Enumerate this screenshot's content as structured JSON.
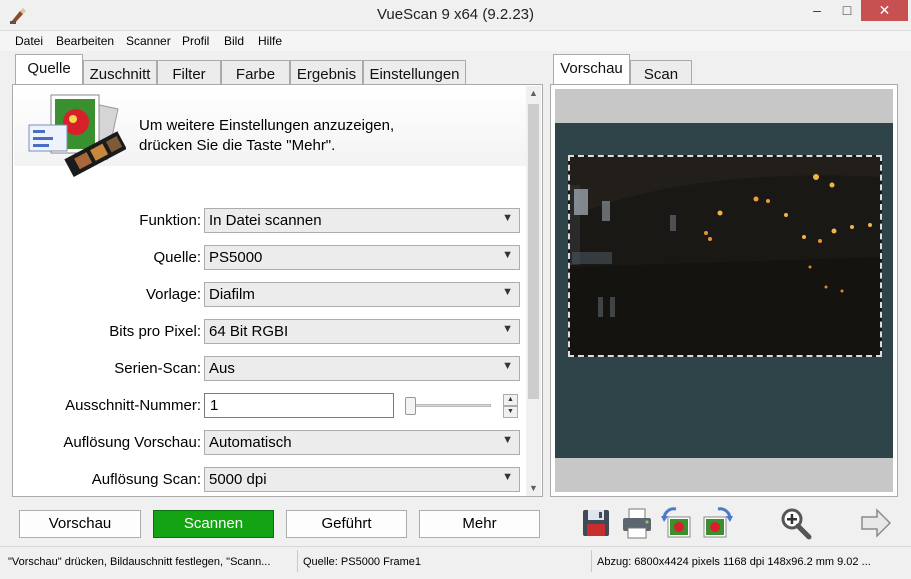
{
  "window": {
    "title": "VueScan 9 x64 (9.2.23)",
    "min": "–",
    "max": "□",
    "close": "✕"
  },
  "menu": [
    "Datei",
    "Bearbeiten",
    "Scanner",
    "Profil",
    "Bild",
    "Hilfe"
  ],
  "left_tabs": [
    "Quelle",
    "Zuschnitt",
    "Filter",
    "Farbe",
    "Ergebnis",
    "Einstellungen"
  ],
  "info": {
    "line1": "Um weitere Einstellungen anzuzeigen,",
    "line2": "drücken Sie die Taste \"Mehr\"."
  },
  "fields": [
    {
      "label": "Funktion:",
      "value": "In Datei scannen"
    },
    {
      "label": "Quelle:",
      "value": "PS5000"
    },
    {
      "label": "Vorlage:",
      "value": "Diafilm"
    },
    {
      "label": "Bits pro Pixel:",
      "value": "64 Bit RGBI"
    },
    {
      "label": "Serien-Scan:",
      "value": "Aus"
    },
    {
      "label": "Ausschnitt-Nummer:",
      "value": "1"
    },
    {
      "label": "Auflösung Vorschau:",
      "value": "Automatisch"
    },
    {
      "label": "Auflösung Scan:",
      "value": "5000 dpi"
    }
  ],
  "right_tabs": [
    "Vorschau",
    "Scan"
  ],
  "buttons": {
    "preview": "Vorschau",
    "scan": "Scannen",
    "guided": "Geführt",
    "more": "Mehr"
  },
  "status": {
    "hint": "\"Vorschau\" drücken, Bildauschnitt festlegen, \"Scann...",
    "source": "Quelle: PS5000 Frame1",
    "output": "Abzug: 6800x4424 pixels 1168 dpi 148x96.2 mm 9.02 ..."
  },
  "colors": {
    "scan_button": "#13a313",
    "film_background": "#2f4448",
    "close_button": "#c75050"
  },
  "icons": [
    "app-icon",
    "scanner-photo-icon",
    "save-icon",
    "print-icon",
    "rotate-left-icon",
    "rotate-right-icon",
    "zoom-in-icon",
    "next-arrow-icon"
  ]
}
